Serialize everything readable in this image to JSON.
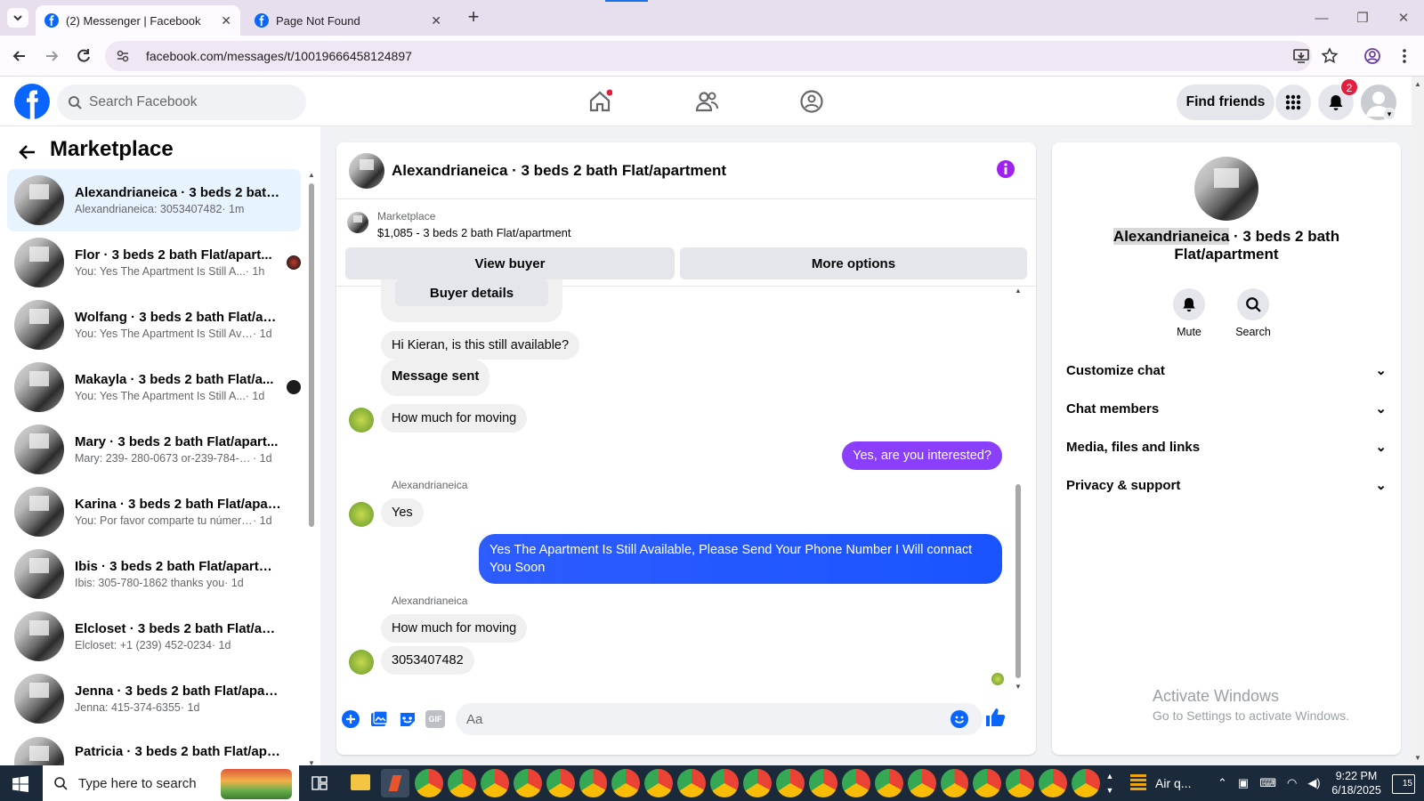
{
  "browser": {
    "tabs": [
      {
        "title": "(2) Messenger | Facebook",
        "active": true
      },
      {
        "title": "Page Not Found",
        "active": false
      }
    ],
    "url": "facebook.com/messages/t/10019666458124897"
  },
  "header": {
    "search_placeholder": "Search Facebook",
    "find_friends": "Find friends",
    "notifications_count": "2"
  },
  "sidebar": {
    "title": "Marketplace",
    "conversations": [
      {
        "name": "Alexandrianeica · 3 beds 2 bath ...",
        "preview": "Alexandrianeica: 3053407482",
        "time": "· 1m",
        "selected": true,
        "seen": ""
      },
      {
        "name": "Flor · 3 beds 2 bath Flat/apart...",
        "preview": "You: Yes The Apartment Is Still A...",
        "time": "· 1h",
        "selected": false,
        "seen": "photo"
      },
      {
        "name": "Wolfang · 3 beds 2 bath Flat/ap...",
        "preview": "You: Yes The Apartment Is Still Avail...",
        "time": "· 1d",
        "selected": false,
        "seen": ""
      },
      {
        "name": "Makayla · 3 beds 2 bath Flat/a...",
        "preview": "You: Yes The Apartment Is Still A...",
        "time": "· 1d",
        "selected": false,
        "seen": "dark"
      },
      {
        "name": "Mary · 3 beds 2 bath Flat/apart...",
        "preview": "Mary: 239- 280-0673 or-239-784-0...",
        "time": "· 1d",
        "selected": false,
        "seen": ""
      },
      {
        "name": "Karina · 3 beds 2 bath Flat/apart...",
        "preview": "You: Por favor comparte tu número...",
        "time": "· 1d",
        "selected": false,
        "seen": ""
      },
      {
        "name": "Ibis · 3 beds 2 bath Flat/apartme...",
        "preview": "Ibis: 305-780-1862 thanks you",
        "time": "· 1d",
        "selected": false,
        "seen": ""
      },
      {
        "name": "Elcloset · 3 beds 2 bath Flat/apa...",
        "preview": "Elcloset: +1 (239) 452-0234",
        "time": "· 1d",
        "selected": false,
        "seen": ""
      },
      {
        "name": "Jenna · 3 beds 2 bath Flat/apart...",
        "preview": "Jenna: 415-374-6355",
        "time": "· 1d",
        "selected": false,
        "seen": ""
      },
      {
        "name": "Patricia · 3 beds 2 bath Flat/apa...",
        "preview": "",
        "time": "",
        "selected": false,
        "seen": ""
      }
    ]
  },
  "chat": {
    "title": "Alexandrianeica · 3 beds 2 bath Flat/apartment",
    "listing_label": "Marketplace",
    "listing_price": "$1,085 - 3 beds 2 bath Flat/apartment",
    "view_buyer": "View buyer",
    "more_options": "More options",
    "buyer_details": "Buyer details",
    "messages": {
      "m1": "Hi Kieran, is this still available?",
      "m2": "Message sent",
      "m3": "How much for moving",
      "m4": "Yes, are you interested?",
      "sender1": "Alexandrianeica",
      "m5": "Yes",
      "m6": "Yes The Apartment Is Still Available, Please Send Your Phone Number I Will connact You Soon",
      "sender2": "Alexandrianeica",
      "m7": "How much for moving",
      "m8": "3053407482"
    },
    "composer_placeholder": "Aa"
  },
  "details": {
    "name_highlight": "Alexandrianeica",
    "name_rest": " · 3 beds 2 bath Flat/apartment",
    "mute": "Mute",
    "search": "Search",
    "sections": [
      "Customize chat",
      "Chat members",
      "Media, files and links",
      "Privacy & support"
    ],
    "watermark_title": "Activate Windows",
    "watermark_sub": "Go to Settings to activate Windows."
  },
  "taskbar": {
    "search_placeholder": "Type here to search",
    "weather": "Air q...",
    "time": "9:22 PM",
    "date": "6/18/2025",
    "notif_count": "15"
  },
  "colors": {
    "fb_blue": "#0866ff",
    "messenger_purple": "#8a3ffc",
    "selected_bg": "#e7f3ff"
  }
}
